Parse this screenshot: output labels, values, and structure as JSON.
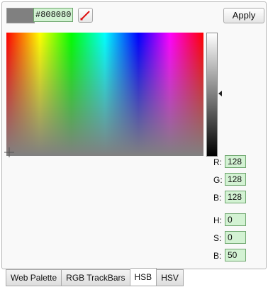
{
  "color": {
    "swatch_color": "#808080",
    "hex_value": "#808080"
  },
  "toolbar": {
    "apply_label": "Apply",
    "eyedropper_icon": "no-color-slash-icon"
  },
  "values": {
    "r_label": "R:",
    "r_value": "128",
    "g_label": "G:",
    "g_value": "128",
    "b_label": "B:",
    "b_value": "128",
    "h_label": "H:",
    "h_value": "0",
    "s_label": "S:",
    "s_value": "0",
    "bb_label": "B:",
    "bb_value": "50"
  },
  "tabs": [
    {
      "label": "Web Palette",
      "active": false
    },
    {
      "label": "RGB TrackBars",
      "active": false
    },
    {
      "label": "HSB",
      "active": true
    },
    {
      "label": "HSV",
      "active": false
    }
  ],
  "colors": {
    "field_bg": "#d3f2d3",
    "field_border": "#6ea66e"
  }
}
